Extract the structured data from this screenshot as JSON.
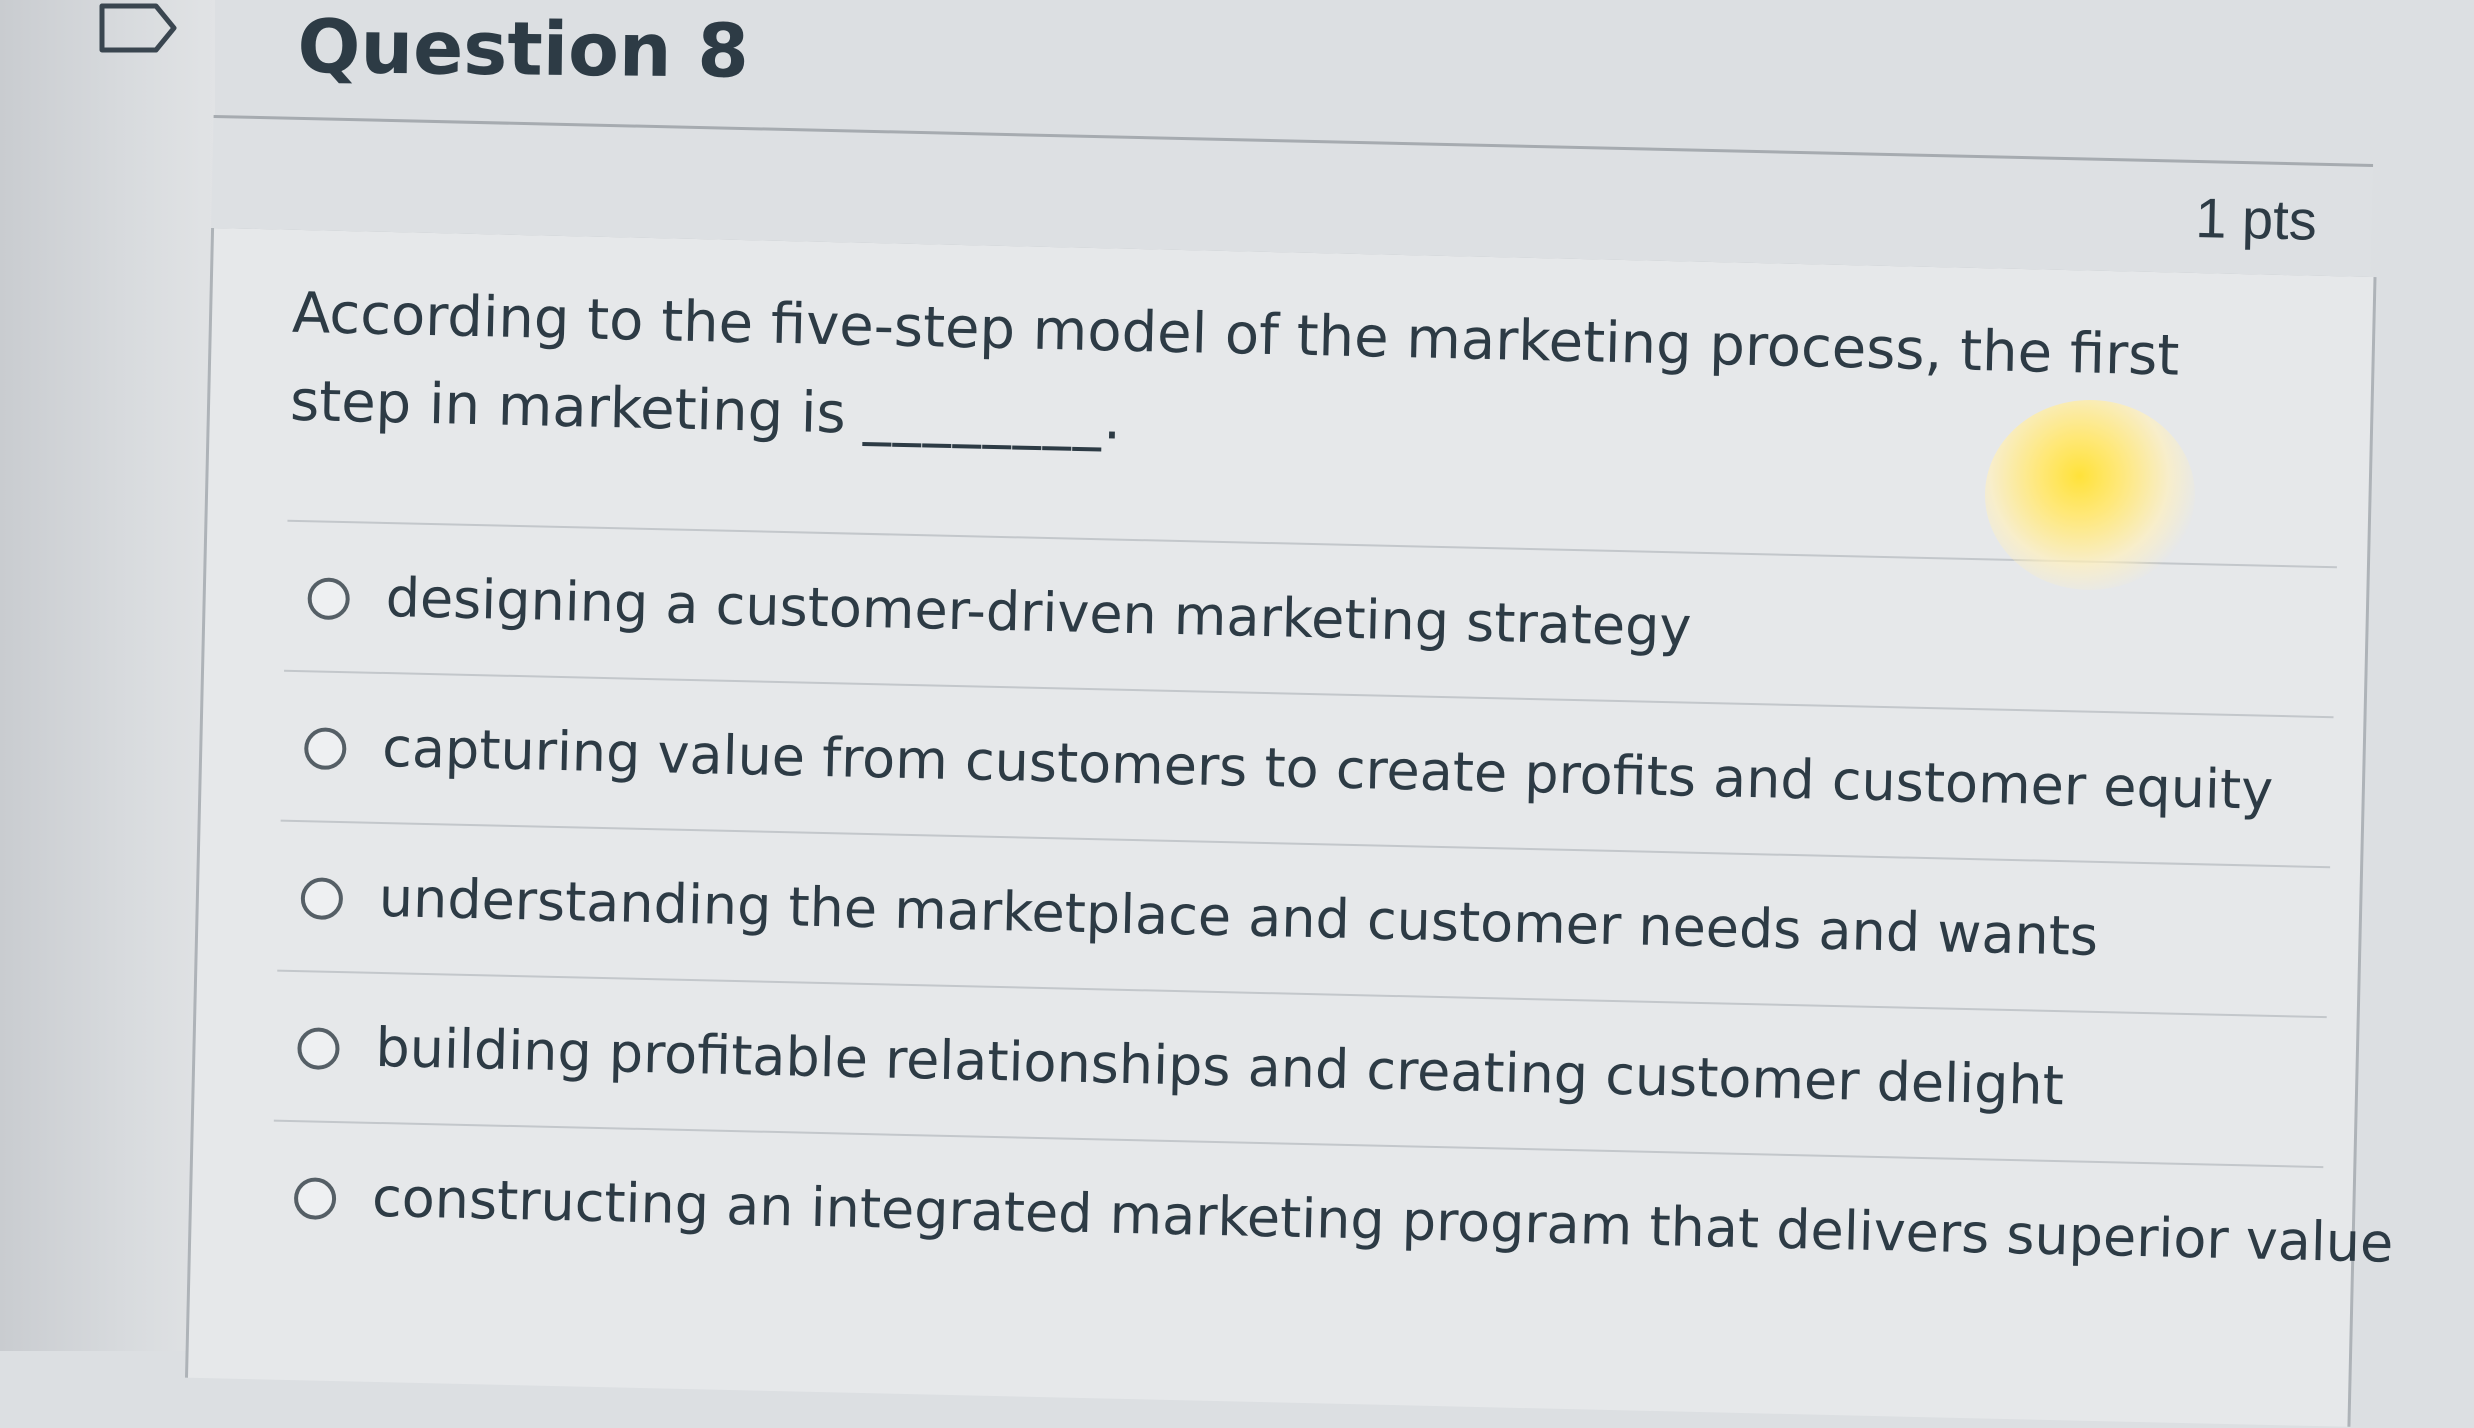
{
  "question": {
    "title": "Question 8",
    "points": "1 pts",
    "prompt_start": "According to the five-step model of the marketing process, the first step in marketing is",
    "blank": "________.",
    "answers": [
      {
        "label": "designing a customer-driven marketing strategy",
        "selected": false
      },
      {
        "label": "capturing value from customers to create profits and customer equity",
        "selected": false
      },
      {
        "label": "understanding the marketplace and customer needs and wants",
        "selected": false
      },
      {
        "label": "building profitable relationships and creating customer delight",
        "selected": false
      },
      {
        "label": "constructing an integrated marketing program that delivers superior value",
        "selected": false
      }
    ]
  },
  "colors": {
    "text": "#2d3b45",
    "header_bg": "#dde0e3",
    "body_bg": "#e6e8ea",
    "border": "#a6abb0"
  }
}
